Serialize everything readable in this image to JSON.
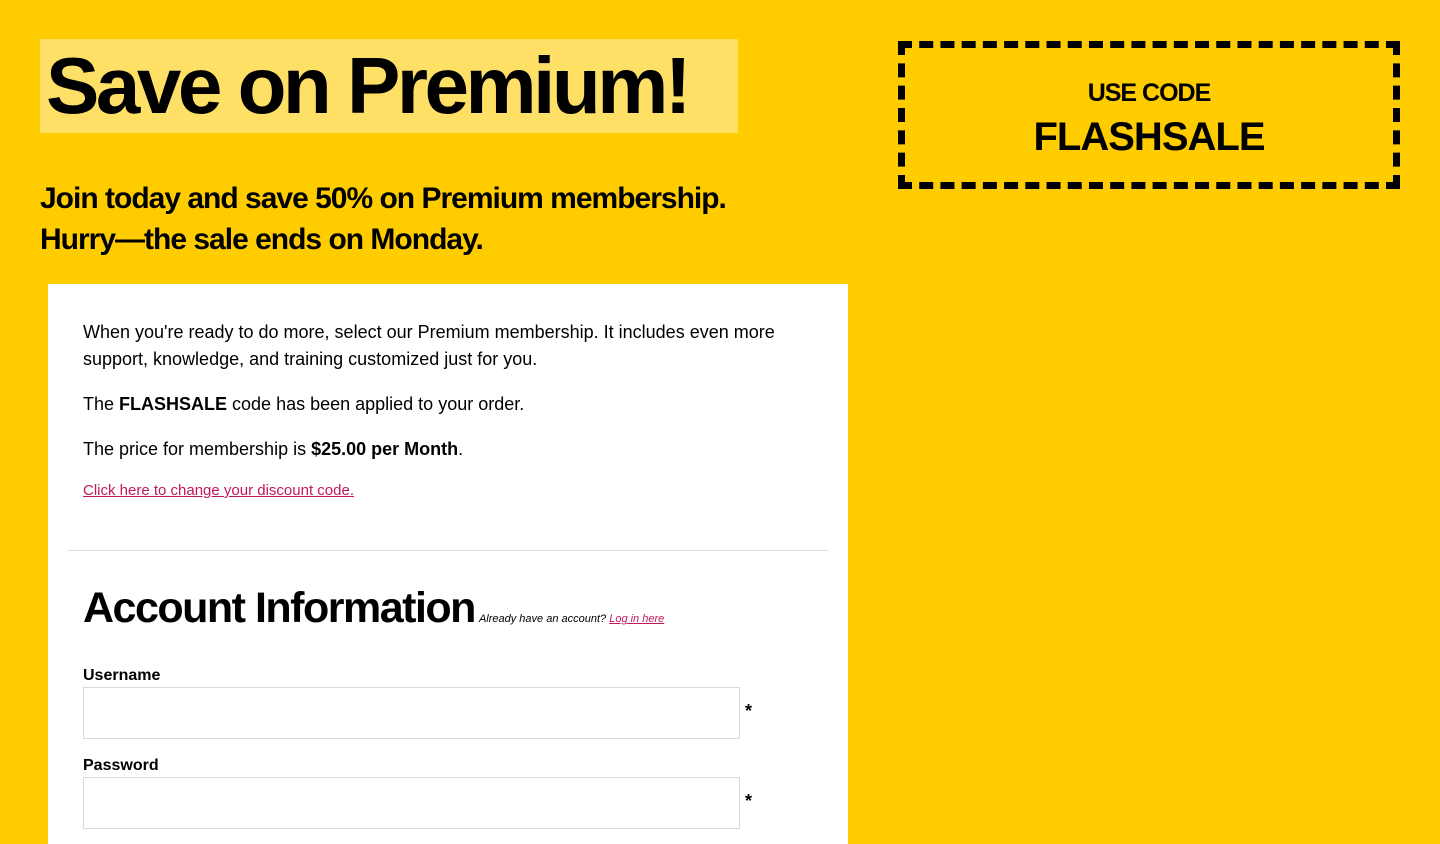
{
  "hero": {
    "title": "Save on Premium!",
    "subtitle_line1": "Join today and save 50% on Premium membership.",
    "subtitle_line2": "Hurry—the sale ends on Monday."
  },
  "coupon": {
    "label": "USE CODE",
    "code": "FLASHSALE"
  },
  "card": {
    "intro": "When you're ready to do more, select our Premium membership. It includes even more support, knowledge, and training customized just for you.",
    "code_prefix": "The ",
    "code_name": "FLASHSALE",
    "code_suffix": " code has been applied to your order.",
    "price_prefix": "The price for membership is ",
    "price_value": "$25.00 per Month",
    "price_suffix": ".",
    "change_link": "Click here to change your discount code."
  },
  "account": {
    "title": "Account Information",
    "hint": "Already have an account?",
    "login_link": "Log in here",
    "fields": [
      {
        "label": "Username",
        "value": "",
        "required_mark": "*"
      },
      {
        "label": "Password",
        "value": "",
        "required_mark": "*"
      }
    ]
  },
  "colors": {
    "background": "#ffcc00",
    "title_highlight": "#ffe066",
    "link": "#c2185b"
  }
}
